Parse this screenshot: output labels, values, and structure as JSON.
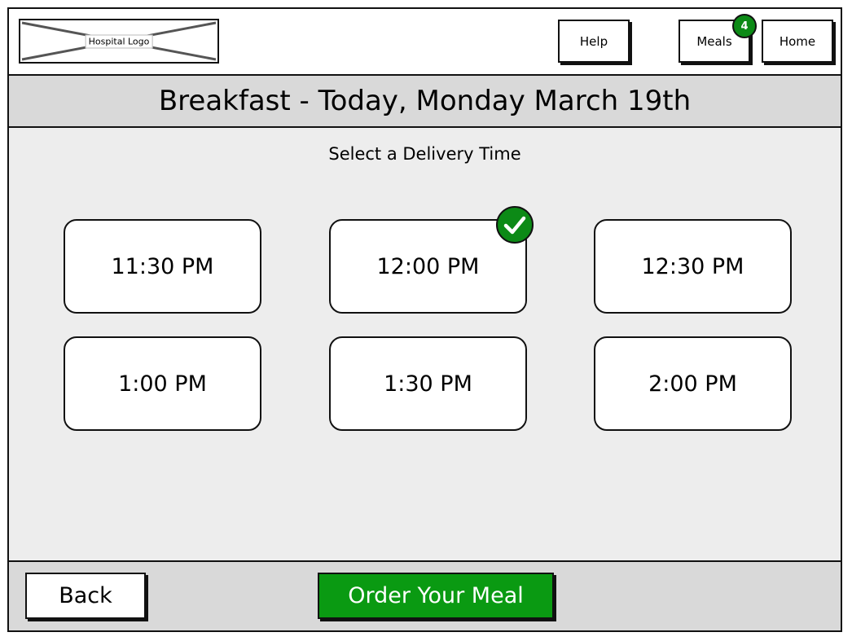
{
  "header": {
    "logo_label": "Hospital Logo",
    "nav": {
      "help": "Help",
      "meals": "Meals",
      "meals_badge": "4",
      "home": "Home"
    }
  },
  "title": "Breakfast - Today, Monday March 19th",
  "subtitle": "Select a Delivery Time",
  "time_slots": [
    {
      "label": "11:30 PM",
      "selected": false
    },
    {
      "label": "12:00 PM",
      "selected": true
    },
    {
      "label": "12:30 PM",
      "selected": false
    },
    {
      "label": "1:00 PM",
      "selected": false
    },
    {
      "label": "1:30 PM",
      "selected": false
    },
    {
      "label": "2:00 PM",
      "selected": false
    }
  ],
  "footer": {
    "back": "Back",
    "order": "Order Your Meal"
  },
  "colors": {
    "accent_green": "#0a9a12",
    "title_bar": "#d9d9d9",
    "content_bg": "#ededed"
  },
  "icons": {
    "selected": "check-icon",
    "logo": "image-placeholder-icon"
  }
}
